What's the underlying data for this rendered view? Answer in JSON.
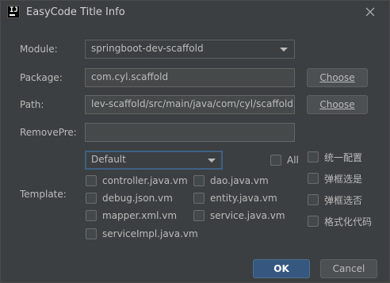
{
  "window": {
    "title": "EasyCode Title Info",
    "icon_letters": "IJ"
  },
  "form": {
    "module_label": "Module:",
    "module_value": "springboot-dev-scaffold",
    "package_label": "Package:",
    "package_value": "com.cyl.scaffold",
    "path_label": "Path:",
    "path_value": "lev-scaffold/src/main/java/com/cyl/scaffold",
    "removepre_label": "RemovePre:",
    "removepre_value": "",
    "choose_label": "Choose",
    "template_label": "Template:",
    "template_group_value": "Default",
    "all_label": "All"
  },
  "templates": [
    "controller.java.vm",
    "dao.java.vm",
    "debug.json.vm",
    "entity.java.vm",
    "mapper.xml.vm",
    "service.java.vm",
    "serviceImpl.java.vm"
  ],
  "options": [
    "统一配置",
    "弹框选是",
    "弹框选否",
    "格式化代码"
  ],
  "buttons": {
    "ok": "OK",
    "cancel": "Cancel"
  },
  "icons": [
    "app-icon",
    "close-icon",
    "dropdown-arrow-icon"
  ]
}
